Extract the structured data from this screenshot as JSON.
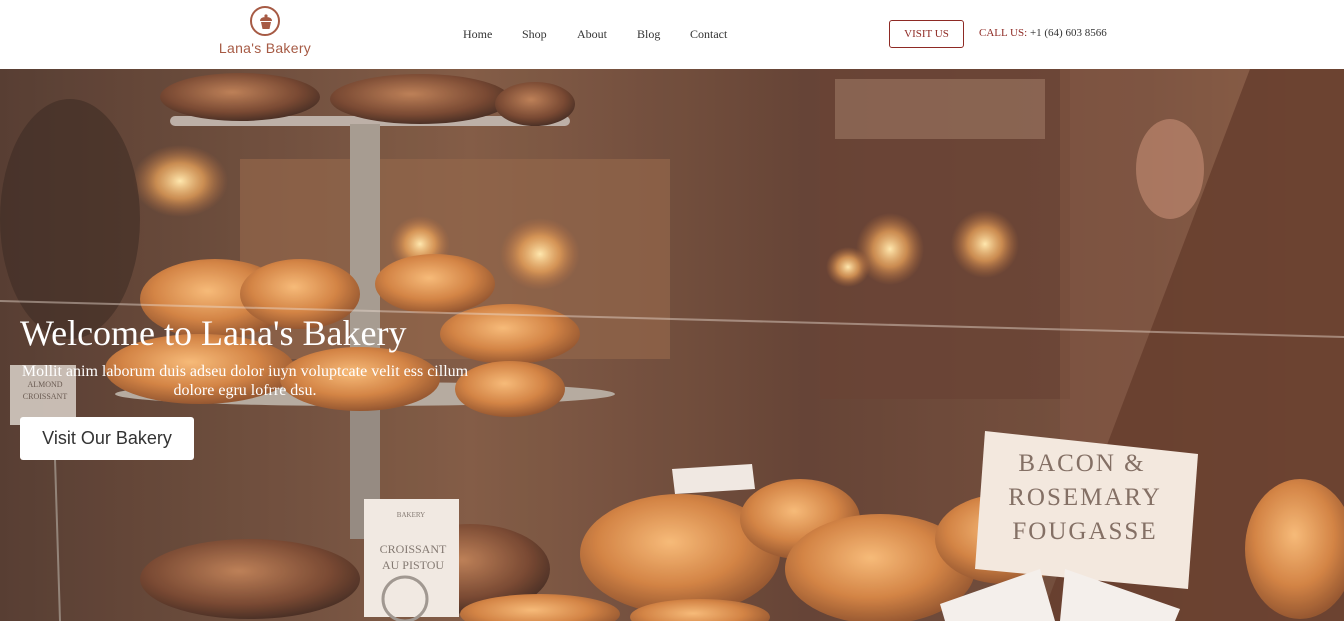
{
  "brand": {
    "name": "Lana's Bakery",
    "logo_icon": "cupcake-icon",
    "accent": "#a65a44"
  },
  "nav": {
    "items": [
      {
        "label": "Home"
      },
      {
        "label": "Shop"
      },
      {
        "label": "About"
      },
      {
        "label": "Blog"
      },
      {
        "label": "Contact"
      }
    ]
  },
  "header_actions": {
    "visit_label": "VISIT US",
    "call_label": "CALL US:",
    "phone": "+1 (64) 603 8566",
    "button_color": "#8e2a24"
  },
  "hero": {
    "title": "Welcome to Lana's Bakery",
    "subtitle": "Mollit anim laborum duis adseu dolor iuyn voluptcate velit ess cillum dolore egru lofrre dsu.",
    "cta_label": "Visit Our Bakery",
    "photo_signs": {
      "big_sign_line1": "BACON &",
      "big_sign_line2": "ROSEMARY",
      "big_sign_line3": "FOUGASSE",
      "small_sign_brand": "BAKERY",
      "small_sign_line1": "CROISSANT",
      "small_sign_line2": "AU PISTOU",
      "left_sign_line1": "ALMOND",
      "left_sign_line2": "CROISSANT"
    }
  }
}
